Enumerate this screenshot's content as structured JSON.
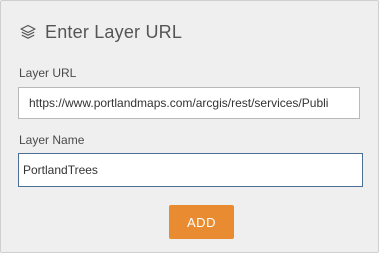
{
  "header": {
    "icon": "layers-icon",
    "title": "Enter Layer URL"
  },
  "layer_url": {
    "label": "Layer URL",
    "value": "https://www.portlandmaps.com/arcgis/rest/services/Publi"
  },
  "layer_name": {
    "label": "Layer Name",
    "value": "PortlandTrees"
  },
  "add_button": {
    "label": "ADD",
    "color": "#e98c31"
  }
}
